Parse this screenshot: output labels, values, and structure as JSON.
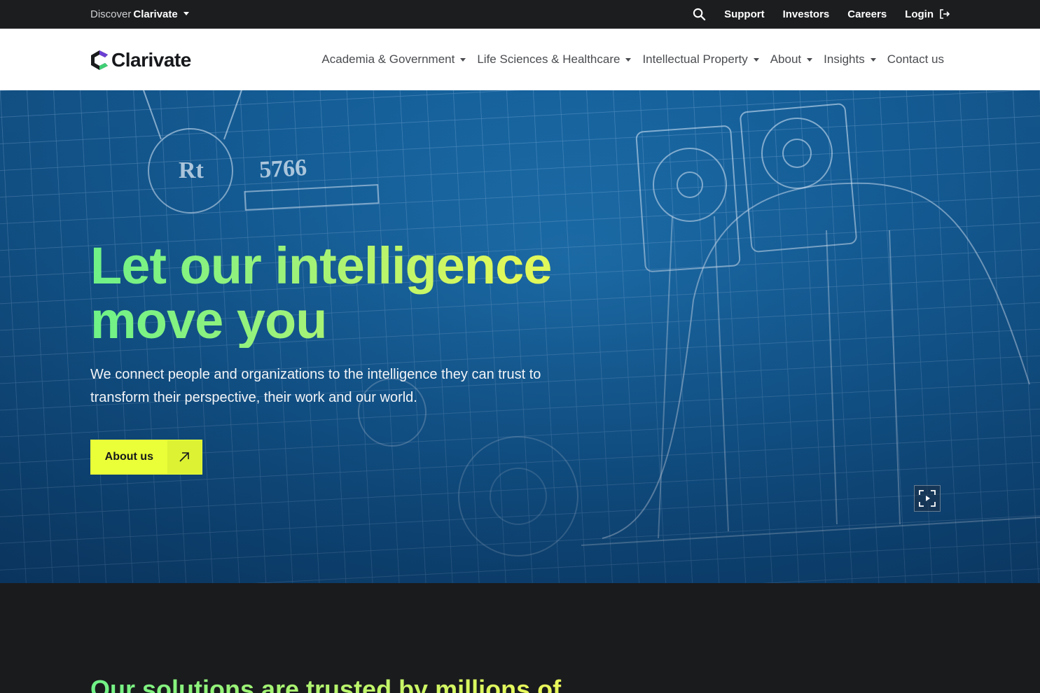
{
  "topbar": {
    "discover_prefix": "Discover",
    "discover_brand": "Clarivate",
    "search_icon": "search-icon",
    "links": [
      "Support",
      "Investors",
      "Careers"
    ],
    "login_label": "Login",
    "login_icon": "logout-arrow-icon"
  },
  "header": {
    "logo_text": "Clarivate",
    "nav": [
      {
        "label": "Academia & Government",
        "has_dropdown": true
      },
      {
        "label": "Life Sciences & Healthcare",
        "has_dropdown": true
      },
      {
        "label": "Intellectual Property",
        "has_dropdown": true
      },
      {
        "label": "About",
        "has_dropdown": true
      },
      {
        "label": "Insights",
        "has_dropdown": true
      },
      {
        "label": "Contact us",
        "has_dropdown": false
      }
    ]
  },
  "hero": {
    "title": "Let our intelligence move you",
    "subtitle": "We connect people and organizations to the intelligence they can trust to transform their perspective, their work and our world.",
    "cta_label": "About us",
    "cta_icon": "arrow-up-right-icon",
    "video_icon": "fullscreen-play-icon",
    "background_labels": [
      "Rt",
      "5766"
    ]
  },
  "section": {
    "title": "Our solutions are trusted by millions of"
  },
  "colors": {
    "topbar_bg": "#1c1d1f",
    "header_bg": "#ffffff",
    "hero_blue": "#155f99",
    "accent_green": "#6ff287",
    "accent_yellow": "#eaff38",
    "dark_bg": "#1a1b1d"
  }
}
